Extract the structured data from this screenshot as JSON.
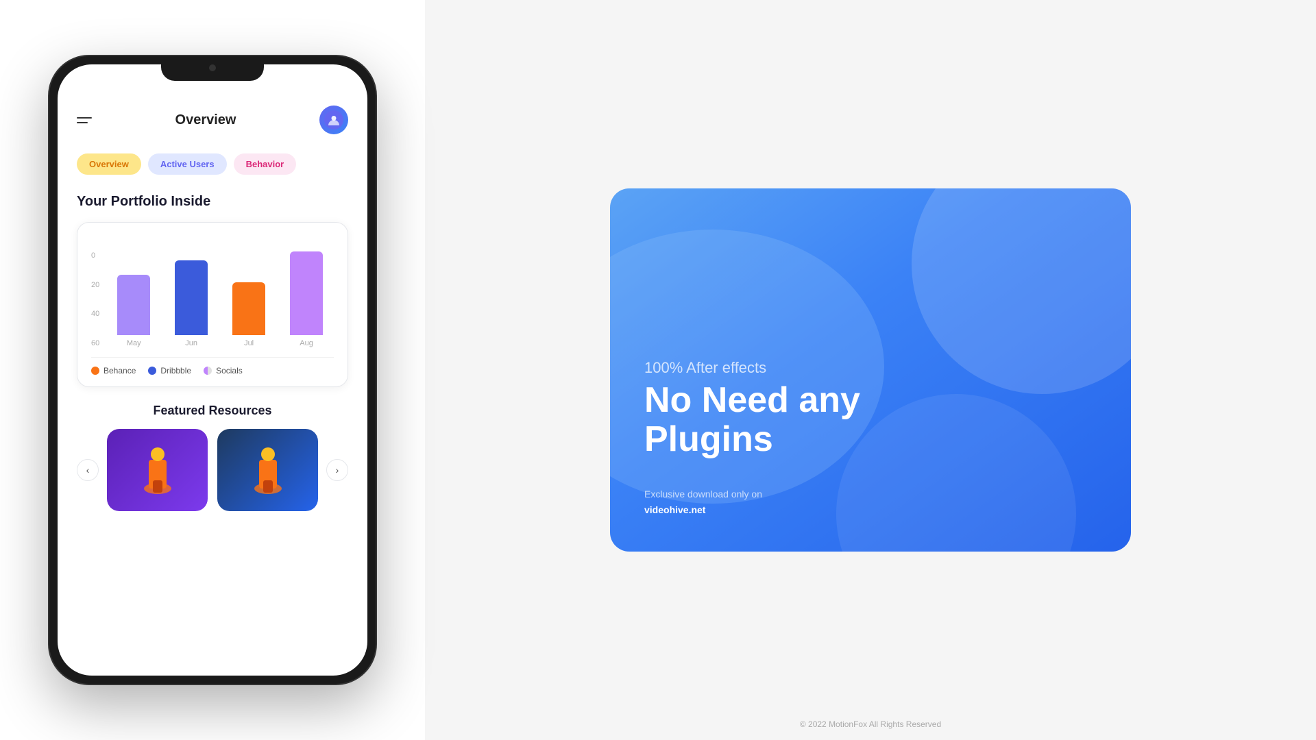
{
  "phone": {
    "title": "Overview",
    "tabs": [
      {
        "label": "Overview",
        "style": "active-overview"
      },
      {
        "label": "Active Users",
        "style": "active-users"
      },
      {
        "label": "Behavior",
        "style": "active-behavior"
      }
    ],
    "portfolio": {
      "section_title": "Your Portfolio Inside",
      "chart": {
        "y_labels": [
          "0",
          "20",
          "40",
          "60"
        ],
        "bars": [
          {
            "month": "May",
            "class": "bar-may",
            "height": "63"
          },
          {
            "month": "Jun",
            "class": "bar-jun",
            "height": "78"
          },
          {
            "month": "Jul",
            "class": "bar-jul",
            "height": "55"
          },
          {
            "month": "Aug",
            "class": "bar-aug",
            "height": "87"
          }
        ],
        "legend": [
          {
            "label": "Behance",
            "dot_class": "legend-dot-behance"
          },
          {
            "label": "Dribbble",
            "dot_class": "legend-dot-dribbble"
          },
          {
            "label": "Socials",
            "dot_class": "legend-dot-socials"
          }
        ]
      }
    },
    "featured": {
      "section_title": "Featured Resources",
      "nav_prev": "‹",
      "nav_next": "›"
    }
  },
  "right_card": {
    "subtitle": "100% After effects",
    "title": "No Need any\nPlugins",
    "footer_text": "Exclusive download only on",
    "footer_link": "videohive.net"
  },
  "footer": {
    "copyright": "© 2022 MotionFox All Rights Reserved"
  }
}
